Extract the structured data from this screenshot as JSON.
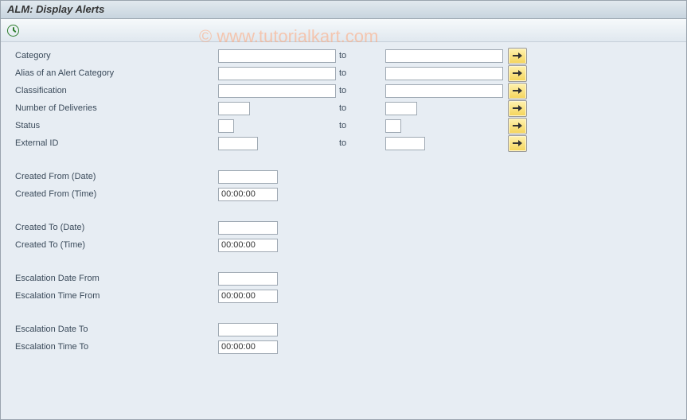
{
  "header": {
    "title": "ALM: Display Alerts"
  },
  "watermark": "© www.tutorialkart.com",
  "labels": {
    "to": "to",
    "category": "Category",
    "alias": "Alias of an Alert Category",
    "classification": "Classification",
    "deliveries": "Number of Deliveries",
    "status": "Status",
    "external_id": "External ID",
    "created_from_date": "Created From (Date)",
    "created_from_time": "Created From (Time)",
    "created_to_date": "Created To (Date)",
    "created_to_time": "Created To (Time)",
    "esc_date_from": "Escalation Date From",
    "esc_time_from": "Escalation Time From",
    "esc_date_to": "Escalation Date To",
    "esc_time_to": "Escalation Time To"
  },
  "values": {
    "category_from": "",
    "category_to": "",
    "alias_from": "",
    "alias_to": "",
    "classification_from": "",
    "classification_to": "",
    "deliveries_from": "",
    "deliveries_to": "",
    "status_from": "",
    "status_to": "",
    "external_id_from": "",
    "external_id_to": "",
    "created_from_date": "",
    "created_from_time": "00:00:00",
    "created_to_date": "",
    "created_to_time": "00:00:00",
    "esc_date_from": "",
    "esc_time_from": "00:00:00",
    "esc_date_to": "",
    "esc_time_to": "00:00:00"
  }
}
